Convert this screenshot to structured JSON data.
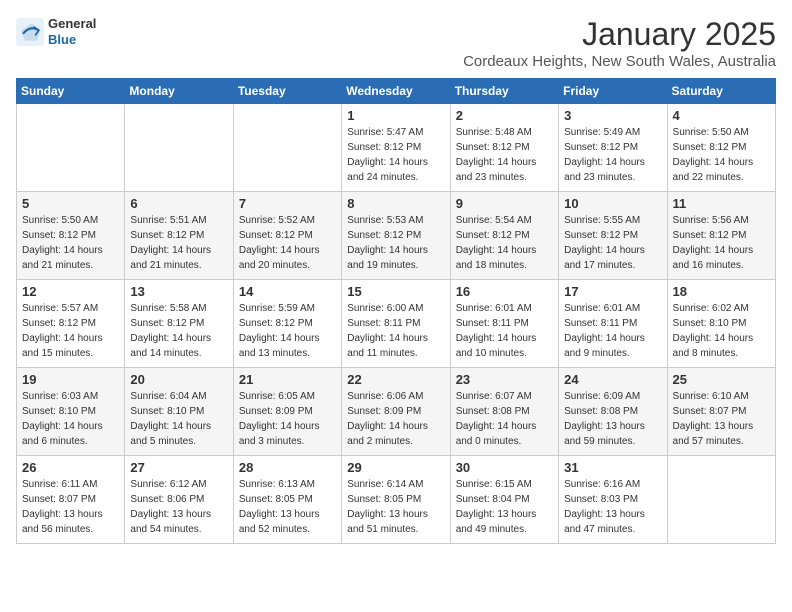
{
  "logo": {
    "general": "General",
    "blue": "Blue"
  },
  "header": {
    "month": "January 2025",
    "location": "Cordeaux Heights, New South Wales, Australia"
  },
  "weekdays": [
    "Sunday",
    "Monday",
    "Tuesday",
    "Wednesday",
    "Thursday",
    "Friday",
    "Saturday"
  ],
  "weeks": [
    [
      {
        "day": "",
        "info": ""
      },
      {
        "day": "",
        "info": ""
      },
      {
        "day": "",
        "info": ""
      },
      {
        "day": "1",
        "info": "Sunrise: 5:47 AM\nSunset: 8:12 PM\nDaylight: 14 hours\nand 24 minutes."
      },
      {
        "day": "2",
        "info": "Sunrise: 5:48 AM\nSunset: 8:12 PM\nDaylight: 14 hours\nand 23 minutes."
      },
      {
        "day": "3",
        "info": "Sunrise: 5:49 AM\nSunset: 8:12 PM\nDaylight: 14 hours\nand 23 minutes."
      },
      {
        "day": "4",
        "info": "Sunrise: 5:50 AM\nSunset: 8:12 PM\nDaylight: 14 hours\nand 22 minutes."
      }
    ],
    [
      {
        "day": "5",
        "info": "Sunrise: 5:50 AM\nSunset: 8:12 PM\nDaylight: 14 hours\nand 21 minutes."
      },
      {
        "day": "6",
        "info": "Sunrise: 5:51 AM\nSunset: 8:12 PM\nDaylight: 14 hours\nand 21 minutes."
      },
      {
        "day": "7",
        "info": "Sunrise: 5:52 AM\nSunset: 8:12 PM\nDaylight: 14 hours\nand 20 minutes."
      },
      {
        "day": "8",
        "info": "Sunrise: 5:53 AM\nSunset: 8:12 PM\nDaylight: 14 hours\nand 19 minutes."
      },
      {
        "day": "9",
        "info": "Sunrise: 5:54 AM\nSunset: 8:12 PM\nDaylight: 14 hours\nand 18 minutes."
      },
      {
        "day": "10",
        "info": "Sunrise: 5:55 AM\nSunset: 8:12 PM\nDaylight: 14 hours\nand 17 minutes."
      },
      {
        "day": "11",
        "info": "Sunrise: 5:56 AM\nSunset: 8:12 PM\nDaylight: 14 hours\nand 16 minutes."
      }
    ],
    [
      {
        "day": "12",
        "info": "Sunrise: 5:57 AM\nSunset: 8:12 PM\nDaylight: 14 hours\nand 15 minutes."
      },
      {
        "day": "13",
        "info": "Sunrise: 5:58 AM\nSunset: 8:12 PM\nDaylight: 14 hours\nand 14 minutes."
      },
      {
        "day": "14",
        "info": "Sunrise: 5:59 AM\nSunset: 8:12 PM\nDaylight: 14 hours\nand 13 minutes."
      },
      {
        "day": "15",
        "info": "Sunrise: 6:00 AM\nSunset: 8:11 PM\nDaylight: 14 hours\nand 11 minutes."
      },
      {
        "day": "16",
        "info": "Sunrise: 6:01 AM\nSunset: 8:11 PM\nDaylight: 14 hours\nand 10 minutes."
      },
      {
        "day": "17",
        "info": "Sunrise: 6:01 AM\nSunset: 8:11 PM\nDaylight: 14 hours\nand 9 minutes."
      },
      {
        "day": "18",
        "info": "Sunrise: 6:02 AM\nSunset: 8:10 PM\nDaylight: 14 hours\nand 8 minutes."
      }
    ],
    [
      {
        "day": "19",
        "info": "Sunrise: 6:03 AM\nSunset: 8:10 PM\nDaylight: 14 hours\nand 6 minutes."
      },
      {
        "day": "20",
        "info": "Sunrise: 6:04 AM\nSunset: 8:10 PM\nDaylight: 14 hours\nand 5 minutes."
      },
      {
        "day": "21",
        "info": "Sunrise: 6:05 AM\nSunset: 8:09 PM\nDaylight: 14 hours\nand 3 minutes."
      },
      {
        "day": "22",
        "info": "Sunrise: 6:06 AM\nSunset: 8:09 PM\nDaylight: 14 hours\nand 2 minutes."
      },
      {
        "day": "23",
        "info": "Sunrise: 6:07 AM\nSunset: 8:08 PM\nDaylight: 14 hours\nand 0 minutes."
      },
      {
        "day": "24",
        "info": "Sunrise: 6:09 AM\nSunset: 8:08 PM\nDaylight: 13 hours\nand 59 minutes."
      },
      {
        "day": "25",
        "info": "Sunrise: 6:10 AM\nSunset: 8:07 PM\nDaylight: 13 hours\nand 57 minutes."
      }
    ],
    [
      {
        "day": "26",
        "info": "Sunrise: 6:11 AM\nSunset: 8:07 PM\nDaylight: 13 hours\nand 56 minutes."
      },
      {
        "day": "27",
        "info": "Sunrise: 6:12 AM\nSunset: 8:06 PM\nDaylight: 13 hours\nand 54 minutes."
      },
      {
        "day": "28",
        "info": "Sunrise: 6:13 AM\nSunset: 8:05 PM\nDaylight: 13 hours\nand 52 minutes."
      },
      {
        "day": "29",
        "info": "Sunrise: 6:14 AM\nSunset: 8:05 PM\nDaylight: 13 hours\nand 51 minutes."
      },
      {
        "day": "30",
        "info": "Sunrise: 6:15 AM\nSunset: 8:04 PM\nDaylight: 13 hours\nand 49 minutes."
      },
      {
        "day": "31",
        "info": "Sunrise: 6:16 AM\nSunset: 8:03 PM\nDaylight: 13 hours\nand 47 minutes."
      },
      {
        "day": "",
        "info": ""
      }
    ]
  ]
}
